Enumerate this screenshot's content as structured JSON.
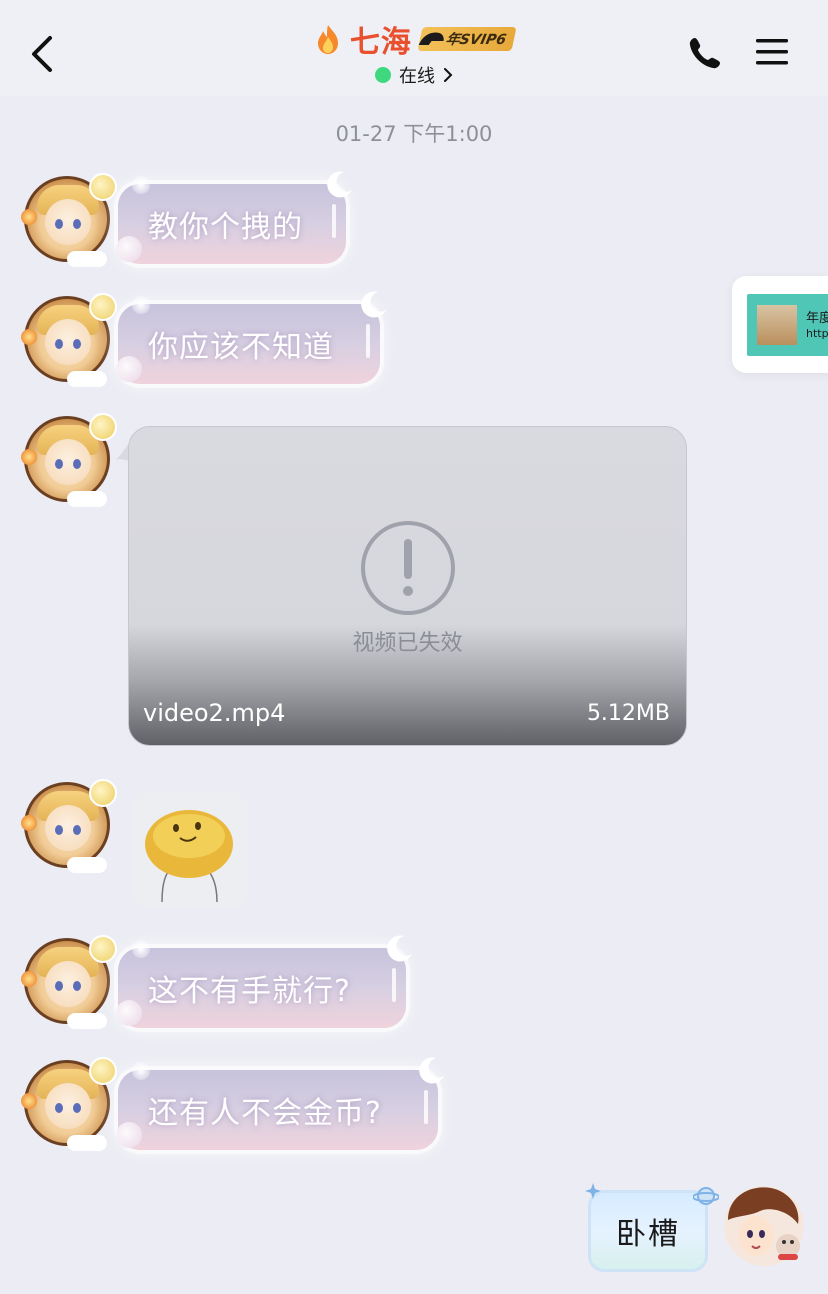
{
  "header": {
    "contact_name": "七海",
    "vip_badge": "年SVIP6",
    "status": "在线",
    "status_color": "#3ed97e",
    "name_color": "#e8502e"
  },
  "timestamp": "01-27 下午1:00",
  "messages": [
    {
      "type": "text",
      "text": "教你个拽的"
    },
    {
      "type": "text",
      "text": "你应该不知道"
    },
    {
      "type": "video",
      "status": "视频已失效",
      "filename": "video2.mp4",
      "size": "5.12MB"
    },
    {
      "type": "sticker",
      "icon": "yellow-blob-sticker"
    },
    {
      "type": "text",
      "text": "这不有手就行?"
    },
    {
      "type": "text",
      "text": "还有人不会金币?"
    }
  ],
  "my_message": {
    "text": "卧槽"
  },
  "floating_card": {
    "title": "年度",
    "url": "http"
  },
  "colors": {
    "background": "#ecedf4",
    "accent": "#e8502e"
  }
}
